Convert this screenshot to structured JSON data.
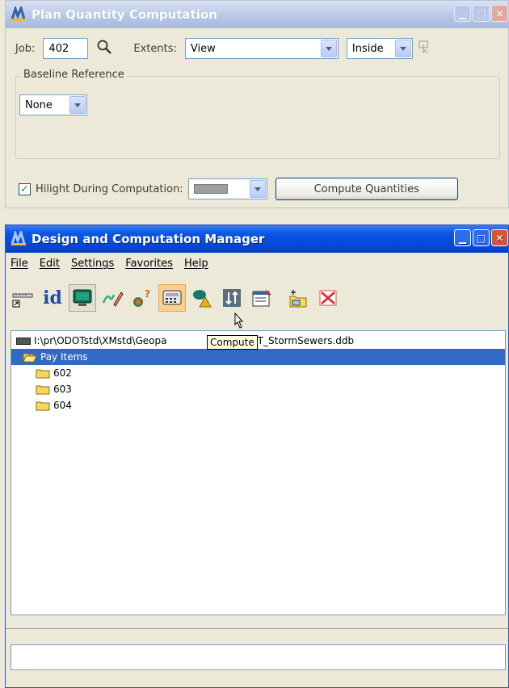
{
  "plan_window": {
    "title": "Plan Quantity Computation",
    "job_label": "Job:",
    "job_value": "402",
    "extents_label": "Extents:",
    "extents_value": "View",
    "inside_value": "Inside",
    "baseline_group": "Baseline Reference",
    "baseline_value": "None",
    "hilight_label": "Hilight During Computation:",
    "hilight_checked": true,
    "compute_button": "Compute Quantities"
  },
  "manager_window": {
    "title": "Design and Computation Manager",
    "menus": [
      "File",
      "Edit",
      "Settings",
      "Favorites",
      "Help"
    ],
    "toolbar_text_id": "id",
    "tooltip": "Compute",
    "path_left": "I:\\pr\\ODOTstd\\XMstd\\Geopa",
    "path_right": "\\ODOT_StormSewers.ddb",
    "tree": [
      {
        "label": "Pay Items",
        "selected": true
      },
      {
        "label": "602",
        "selected": false
      },
      {
        "label": "603",
        "selected": false
      },
      {
        "label": "604",
        "selected": false
      }
    ]
  },
  "colors": {
    "selection": "#316ac5",
    "title_active": "#0a57e5",
    "tooltip_bg": "#ffffe1"
  }
}
